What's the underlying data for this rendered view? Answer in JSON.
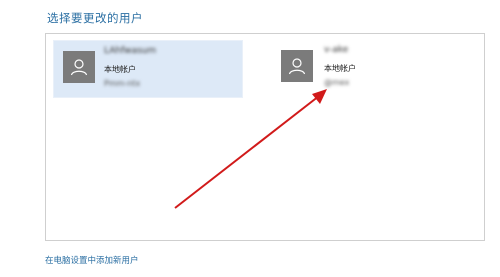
{
  "page": {
    "title": "选择要更改的用户"
  },
  "users": [
    {
      "name": "LAhfwasum",
      "account_type": "本地帐户",
      "meta": "Pmm-ntx",
      "selected": true,
      "avatar_icon": "user-silhouette-icon"
    },
    {
      "name": "v-ake",
      "account_type": "本地帐户",
      "meta": "@mex",
      "selected": false,
      "avatar_icon": "user-silhouette-icon"
    }
  ],
  "footer": {
    "add_user_link": "在电脑设置中添加新用户"
  },
  "annotation": {
    "arrow_icon": "red-arrow-icon",
    "color": "#d11a1a"
  },
  "colors": {
    "accent": "#2b6fa3",
    "selected_tile": "#dde9f7",
    "avatar_bg": "#7b7b7b"
  }
}
